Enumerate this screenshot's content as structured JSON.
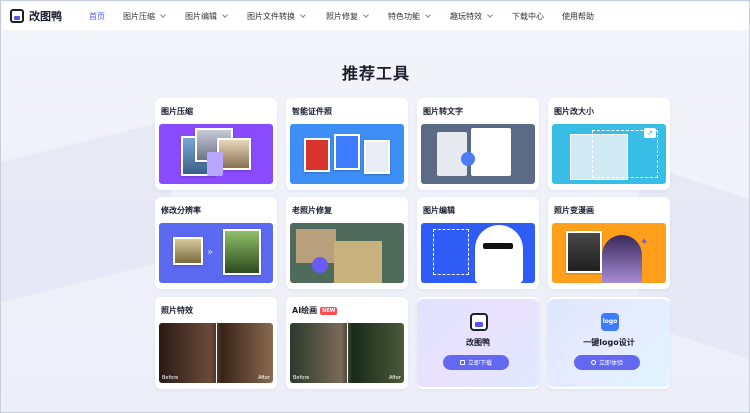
{
  "nav": {
    "logo": "改图鸭",
    "items": [
      {
        "label": "首页",
        "active": true,
        "dropdown": false
      },
      {
        "label": "图片压缩",
        "active": false,
        "dropdown": true
      },
      {
        "label": "图片编辑",
        "active": false,
        "dropdown": true
      },
      {
        "label": "图片文件转换",
        "active": false,
        "dropdown": true
      },
      {
        "label": "照片修复",
        "active": false,
        "dropdown": true
      },
      {
        "label": "特色功能",
        "active": false,
        "dropdown": true
      },
      {
        "label": "趣玩特效",
        "active": false,
        "dropdown": true
      },
      {
        "label": "下载中心",
        "active": false,
        "dropdown": false
      },
      {
        "label": "使用帮助",
        "active": false,
        "dropdown": false
      }
    ]
  },
  "main": {
    "title": "推荐工具",
    "cards": [
      {
        "title": "图片压缩"
      },
      {
        "title": "智能证件照"
      },
      {
        "title": "图片转文字"
      },
      {
        "title": "图片改大小"
      },
      {
        "title": "修改分辨率"
      },
      {
        "title": "老照片修复"
      },
      {
        "title": "图片编辑"
      },
      {
        "title": "照片变漫画"
      },
      {
        "title": "照片特效",
        "before": "Before",
        "after": "After"
      },
      {
        "title": "AI绘画",
        "badge": "NEW",
        "before": "Before",
        "after": "After"
      }
    ],
    "promos": [
      {
        "name": "改图鸭",
        "button": "立即下载"
      },
      {
        "name": "一键logo设计",
        "button": "立即体验",
        "icon_text": "logo"
      }
    ]
  },
  "colors": {
    "accent": "#4f5bff",
    "purple": "#8a4bff",
    "blue": "#3d7bff",
    "orange": "#ff9f1c",
    "button": "#6268f0"
  }
}
